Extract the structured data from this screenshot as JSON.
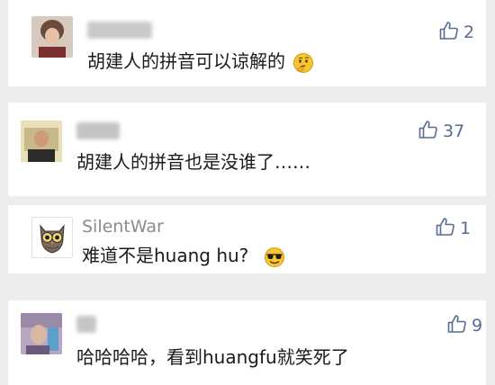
{
  "comments": [
    {
      "name": "",
      "text": "胡建人的拼音可以谅解的",
      "likes": "2",
      "emoji": "thinking-emoji",
      "avatar": "blurred-avatar"
    },
    {
      "name": "",
      "text": "胡建人的拼音也是没谁了……",
      "likes": "37",
      "emoji": "",
      "avatar": "blurred-avatar"
    },
    {
      "name": "SilentWar",
      "text": "难道不是huang hu?",
      "likes": "1",
      "emoji": "sunglasses-emoji",
      "avatar": "owl-avatar"
    },
    {
      "name": "",
      "text": "哈哈哈哈，看到huangfu就笑死了",
      "likes": "9",
      "emoji": "",
      "avatar": "blurred-avatar"
    }
  ],
  "colors": {
    "background": "#ededed",
    "card": "#ffffff",
    "like": "#576b95",
    "name": "#8b8b8b",
    "text": "#1a1a1a"
  }
}
